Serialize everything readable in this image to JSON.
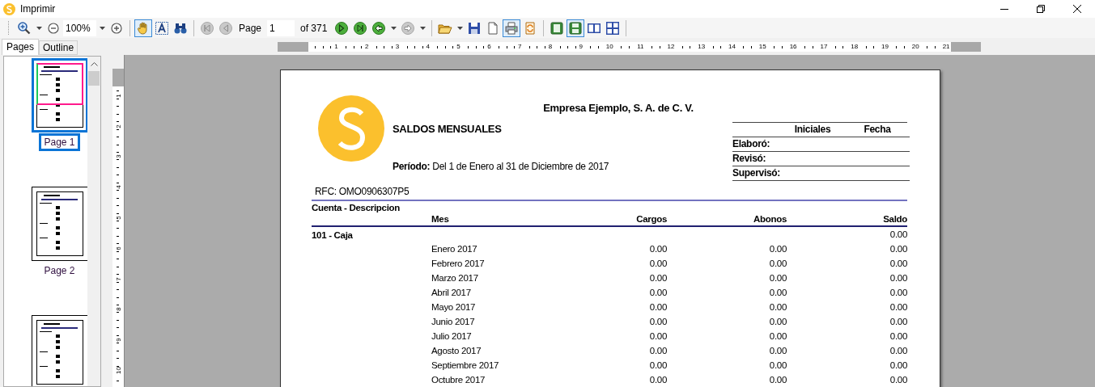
{
  "window": {
    "title": "Imprimir"
  },
  "toolbar": {
    "zoom_in": {
      "kind": "zoom-in"
    },
    "zoom_value": "100%",
    "tools": [
      {
        "kind": "hand",
        "selected": true
      },
      {
        "kind": "text",
        "selected": false
      },
      {
        "kind": "find",
        "selected": false
      }
    ],
    "nav_before": [
      {
        "kind": "first",
        "disabled": true
      },
      {
        "kind": "previous",
        "disabled": true
      }
    ],
    "page_label": "Page",
    "page_value": "1",
    "page_count": "of 371",
    "nav_after": [
      {
        "kind": "next",
        "disabled": false,
        "dropdown": false
      },
      {
        "kind": "last",
        "disabled": false,
        "dropdown": false
      },
      {
        "kind": "back",
        "disabled": false,
        "dropdown": true
      },
      {
        "kind": "forward",
        "disabled": true,
        "dropdown": true
      }
    ],
    "file_tools": [
      {
        "kind": "open",
        "selected": false,
        "dropdown": true
      },
      {
        "kind": "save",
        "selected": false,
        "dropdown": false
      },
      {
        "kind": "page-setup",
        "selected": false,
        "dropdown": false
      },
      {
        "kind": "print",
        "selected": true,
        "dropdown": false
      },
      {
        "kind": "export",
        "selected": false,
        "dropdown": false
      }
    ],
    "view_modes": [
      {
        "kind": "single",
        "selected": false
      },
      {
        "kind": "continuous",
        "selected": true
      },
      {
        "kind": "facing",
        "selected": false
      },
      {
        "kind": "grid",
        "selected": false
      }
    ]
  },
  "sidebar": {
    "tabs": [
      {
        "label": "Pages",
        "selected": true
      },
      {
        "label": "Outline",
        "selected": false
      }
    ],
    "thumbnails": [
      {
        "label": "Page 1",
        "selected": true
      },
      {
        "label": "Page 2",
        "selected": false
      },
      {
        "selected": false
      }
    ]
  },
  "rulers": {
    "horizontal": [
      "1",
      "2",
      "3",
      "4",
      "5",
      "6",
      "7",
      "8",
      "9",
      "10",
      "11",
      "12",
      "13",
      "14",
      "15",
      "16",
      "17",
      "18",
      "19",
      "20",
      "21"
    ],
    "vertical": [
      "1",
      "2",
      "3",
      "4",
      "5",
      "6",
      "7",
      "8",
      "9",
      "10"
    ]
  },
  "report": {
    "company": "Empresa Ejemplo, S. A. de C. V.",
    "title": "SALDOS MENSUALES",
    "period": "**Período:** Del 1 de Enero al 31 de Diciembre de 2017",
    "rfc": "RFC: OMO0906307P5",
    "signature_columns": [
      "Iniciales",
      "Fecha"
    ],
    "signature_rows": [
      "Elaboró:",
      "Revisó:",
      "Supervisó:"
    ],
    "group_header": "Cuenta - Descripcion",
    "columns": [
      "Mes",
      "Cargos",
      "Abonos",
      "Saldo"
    ],
    "accounts": [
      {
        "name": "101 - Caja",
        "saldo": "0.00",
        "rows": [
          {
            "month": "Enero 2017",
            "cargos": "0.00",
            "abonos": "0.00",
            "saldo": "0.00"
          },
          {
            "month": "Febrero 2017",
            "cargos": "0.00",
            "abonos": "0.00",
            "saldo": "0.00"
          },
          {
            "month": "Marzo 2017",
            "cargos": "0.00",
            "abonos": "0.00",
            "saldo": "0.00"
          },
          {
            "month": "Abril 2017",
            "cargos": "0.00",
            "abonos": "0.00",
            "saldo": "0.00"
          },
          {
            "month": "Mayo 2017",
            "cargos": "0.00",
            "abonos": "0.00",
            "saldo": "0.00"
          },
          {
            "month": "Junio 2017",
            "cargos": "0.00",
            "abonos": "0.00",
            "saldo": "0.00"
          },
          {
            "month": "Julio 2017",
            "cargos": "0.00",
            "abonos": "0.00",
            "saldo": "0.00"
          },
          {
            "month": "Agosto 2017",
            "cargos": "0.00",
            "abonos": "0.00",
            "saldo": "0.00"
          },
          {
            "month": "Septiembre 2017",
            "cargos": "0.00",
            "abonos": "0.00",
            "saldo": "0.00"
          },
          {
            "month": "Octubre 2017",
            "cargos": "0.00",
            "abonos": "0.00",
            "saldo": "0.00"
          }
        ]
      }
    ]
  }
}
